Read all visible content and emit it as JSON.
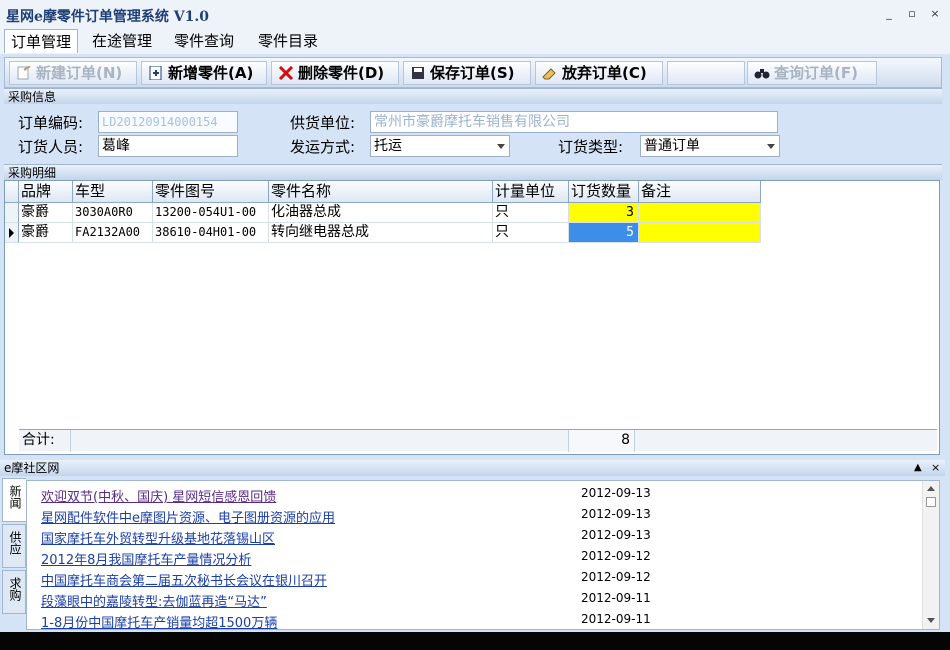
{
  "app": {
    "title": "星网e摩零件订单管理系统 V1.0"
  },
  "window_controls": {
    "minimize": "_",
    "restore": "▫",
    "close": "×"
  },
  "menu": [
    "订单管理",
    "在途管理",
    "零件查询",
    "零件目录"
  ],
  "toolbar": {
    "new_order": "新建订单(N)",
    "add_part": "新增零件(A)",
    "delete_part": "删除零件(D)",
    "save_order": "保存订单(S)",
    "cancel_order": "放弃订单(C)",
    "query_order": "查询订单(F)"
  },
  "procurement_info": {
    "header": "采购信息",
    "order_no_label": "订单编码:",
    "order_no": "LD20120914000154",
    "supplier_label": "供货单位:",
    "supplier": "常州市豪爵摩托车销售有限公司",
    "orderer_label": "订货人员:",
    "orderer": "葛峰",
    "shipping_label": "发运方式:",
    "shipping": "托运",
    "order_type_label": "订货类型:",
    "order_type": "普通订单"
  },
  "detail": {
    "header": "采购明细",
    "columns": [
      "品牌",
      "车型",
      "零件图号",
      "零件名称",
      "计量单位",
      "订货数量",
      "备注"
    ],
    "rows": [
      {
        "brand": "豪爵",
        "model": "3030A0R0",
        "part_no": "13200-054U1-00",
        "part_name": "化油器总成",
        "unit": "只",
        "qty": "3",
        "note": ""
      },
      {
        "brand": "豪爵",
        "model": "FA2132A00",
        "part_no": "38610-04H01-00",
        "part_name": "转向继电器总成",
        "unit": "只",
        "qty": "5",
        "note": ""
      }
    ],
    "sum_label": "合计:",
    "sum_value": "8"
  },
  "news": {
    "header": "e摩社区网",
    "tabs": [
      "新闻",
      "供应",
      "求购"
    ],
    "items": [
      {
        "title": "欢迎双节(中秋、国庆) 星网短信感恩回馈",
        "date": "2012-09-13"
      },
      {
        "title": "星网配件软件中e摩图片资源、电子图册资源的应用",
        "date": "2012-09-13"
      },
      {
        "title": "国家摩托车外贸转型升级基地花落锡山区",
        "date": "2012-09-13"
      },
      {
        "title": "2012年8月我国摩托车产量情况分析",
        "date": "2012-09-12"
      },
      {
        "title": "中国摩托车商会第二届五次秘书长会议在银川召开",
        "date": "2012-09-12"
      },
      {
        "title": "段藻眼中的嘉陵转型:去伽蓝再造“马达”",
        "date": "2012-09-11"
      },
      {
        "title": "1-8月份中国摩托车产销量均超1500万辆",
        "date": "2012-09-11"
      }
    ]
  },
  "colors": {
    "highlight_yellow": "#ffff00",
    "selection_blue": "#3d8ee8",
    "link_blue": "#1b3fa8"
  }
}
